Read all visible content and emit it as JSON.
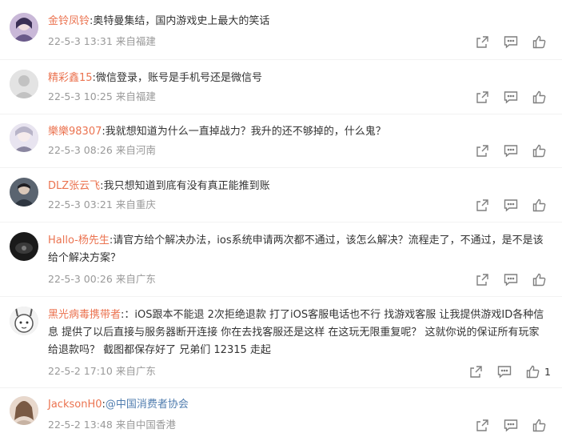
{
  "comments": [
    {
      "user": "金铃凤铃",
      "text": "奥特曼集结，国内游戏史上最大的笑话",
      "date": "22-5-3 13:31",
      "location": "来自福建",
      "likes": ""
    },
    {
      "user": "精彩鑫15",
      "text": "微信登录，账号是手机号还是微信号",
      "date": "22-5-3 10:25",
      "location": "来自福建",
      "likes": ""
    },
    {
      "user": "樂樂98307",
      "text": "我就想知道为什么一直掉战力？我升的还不够掉的，什么鬼？",
      "date": "22-5-3 08:26",
      "location": "来自河南",
      "likes": ""
    },
    {
      "user": "DLZ张云飞",
      "text": "我只想知道到底有没有真正能推到账",
      "date": "22-5-3 03:21",
      "location": "来自重庆",
      "likes": ""
    },
    {
      "user": "Hallo-杨先生",
      "text": "请官方给个解决办法，ios系统申请两次都不通过，该怎么解决？流程走了，不通过，是不是该给个解决方案？",
      "date": "22-5-3 00:26",
      "location": "来自广东",
      "likes": ""
    },
    {
      "user": "黑光病毒携带者",
      "text": "：iOS跟本不能退 2次拒绝退款  打了iOS客服电话也不行        找游戏客服  让我提供游戏ID各种信息  提供了以后直接与服务器断开连接      你在去找客服还是这样  在这玩无限重复呢？  这就你说的保证所有玩家给退款吗？  截图都保存好了  兄弟们  12315  走起",
      "date": "22-5-2 17:10",
      "location": "来自广东",
      "likes": "1"
    },
    {
      "user": "JacksonH0",
      "text": "@中国消费者协会",
      "date": "22-5-2 13:48",
      "location": "来自中国香港",
      "likes": ""
    }
  ],
  "colors": {
    "username": "#eb7350",
    "meta": "#999999",
    "icon": "#7f7f7f"
  },
  "icons": {
    "share": "share-icon",
    "comment": "comment-icon",
    "like": "like-icon"
  }
}
